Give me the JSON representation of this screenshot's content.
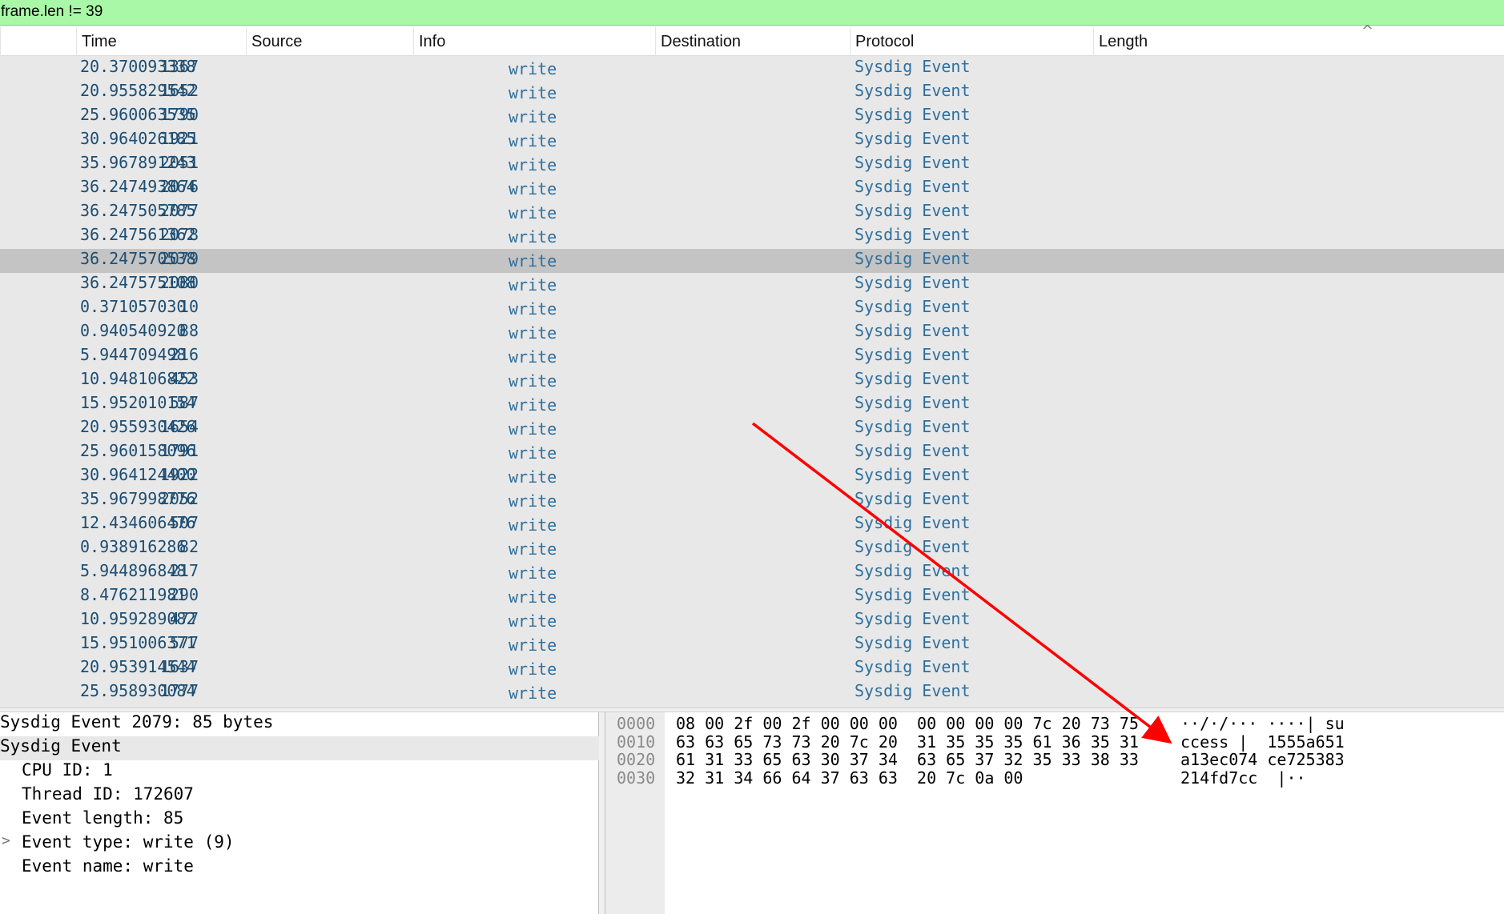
{
  "filter": {
    "text": "frame.len != 39"
  },
  "columns": [
    "Time",
    "Source",
    "Info",
    "Destination",
    "Protocol",
    "Length"
  ],
  "packets": [
    {
      "no": "1367",
      "time": "20.370093338",
      "info": "write",
      "protocol": "Sysdig Event"
    },
    {
      "no": "1652",
      "time": "20.955829542",
      "info": "write",
      "protocol": "Sysdig Event"
    },
    {
      "no": "1790",
      "time": "25.960063535",
      "info": "write",
      "protocol": "Sysdig Event"
    },
    {
      "no": "1921",
      "time": "30.964026185",
      "info": "write",
      "protocol": "Sysdig Event"
    },
    {
      "no": "2051",
      "time": "35.967891243",
      "info": "write",
      "protocol": "Sysdig Event"
    },
    {
      "no": "2076",
      "time": "36.247493864",
      "info": "write",
      "protocol": "Sysdig Event"
    },
    {
      "no": "2077",
      "time": "36.247505785",
      "info": "write",
      "protocol": "Sysdig Event"
    },
    {
      "no": "2078",
      "time": "36.247561362",
      "info": "write",
      "protocol": "Sysdig Event"
    },
    {
      "no": "2079",
      "time": "36.247570538",
      "info": "write",
      "protocol": "Sysdig Event",
      "selected": true
    },
    {
      "no": "2080",
      "time": "36.247575108",
      "info": "write",
      "protocol": "Sysdig Event"
    },
    {
      "no": "10",
      "time": "0.371057030",
      "info": "write",
      "protocol": "Sysdig Event"
    },
    {
      "no": "88",
      "time": "0.940540920",
      "info": "write",
      "protocol": "Sysdig Event"
    },
    {
      "no": "216",
      "time": "5.944709498",
      "info": "write",
      "protocol": "Sysdig Event"
    },
    {
      "no": "453",
      "time": "10.948106822",
      "info": "write",
      "protocol": "Sysdig Event"
    },
    {
      "no": "587",
      "time": "15.952010154",
      "info": "write",
      "protocol": "Sysdig Event"
    },
    {
      "no": "1654",
      "time": "20.955930426",
      "info": "write",
      "protocol": "Sysdig Event"
    },
    {
      "no": "1791",
      "time": "25.960158096",
      "info": "write",
      "protocol": "Sysdig Event"
    },
    {
      "no": "1922",
      "time": "30.964124400",
      "info": "write",
      "protocol": "Sysdig Event"
    },
    {
      "no": "2052",
      "time": "35.967998776",
      "info": "write",
      "protocol": "Sysdig Event"
    },
    {
      "no": "507",
      "time": "12.434606476",
      "info": "write",
      "protocol": "Sysdig Event"
    },
    {
      "no": "82",
      "time": "0.938916286",
      "info": "write",
      "protocol": "Sysdig Event"
    },
    {
      "no": "217",
      "time": "5.944896848",
      "info": "write",
      "protocol": "Sysdig Event"
    },
    {
      "no": "290",
      "time": "8.476211981",
      "info": "write",
      "protocol": "Sysdig Event"
    },
    {
      "no": "477",
      "time": "10.959289082",
      "info": "write",
      "protocol": "Sysdig Event"
    },
    {
      "no": "577",
      "time": "15.951006371",
      "info": "write",
      "protocol": "Sysdig Event"
    },
    {
      "no": "1637",
      "time": "20.953914544",
      "info": "write",
      "protocol": "Sysdig Event"
    },
    {
      "no": "1777",
      "time": "25.958930084",
      "info": "write",
      "protocol": "Sysdig Event"
    }
  ],
  "details": {
    "summary": "Sysdig Event 2079: 85 bytes",
    "root": "Sysdig Event",
    "fields": [
      "CPU ID: 1",
      "Thread ID: 172607",
      "Event length: 85",
      "Event type: write (9)",
      "Event name: write"
    ],
    "expander_glyph": ">"
  },
  "bytes": [
    {
      "offset": "0000",
      "hex": "08 00 2f 00 2f 00 00 00  00 00 00 00 7c 20 73 75",
      "ascii": "··/·/··· ····| su"
    },
    {
      "offset": "0010",
      "hex": "63 63 65 73 73 20 7c 20  31 35 35 35 61 36 35 31",
      "ascii": "ccess |  1555a651"
    },
    {
      "offset": "0020",
      "hex": "61 31 33 65 63 30 37 34  63 65 37 32 35 33 38 33",
      "ascii": "a13ec074 ce725383"
    },
    {
      "offset": "0030",
      "hex": "32 31 34 66 64 37 63 63  20 7c 0a 00",
      "ascii": "214fd7cc  |··"
    }
  ],
  "sort_icon": "^",
  "annotation_color": "#ff0000"
}
